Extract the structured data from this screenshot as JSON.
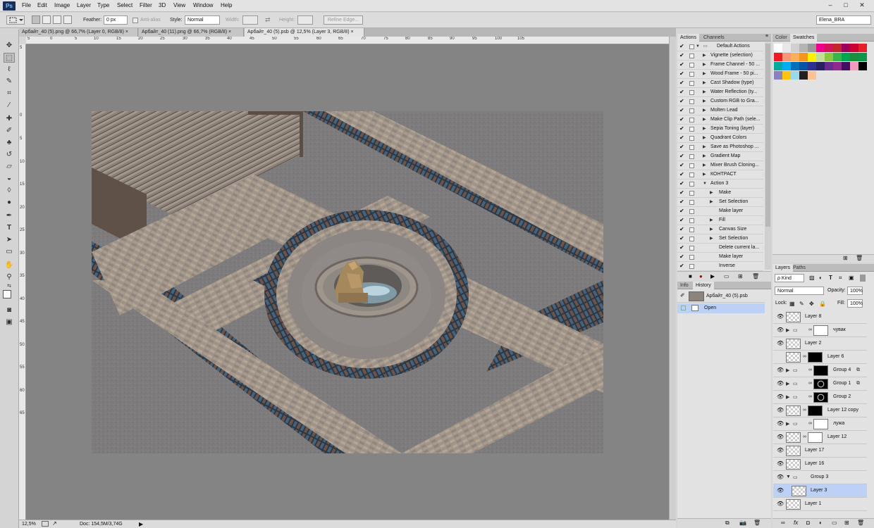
{
  "app": {
    "logo": "Ps",
    "user": "Elena_BRA"
  },
  "menu": [
    "File",
    "Edit",
    "Image",
    "Layer",
    "Type",
    "Select",
    "Filter",
    "3D",
    "View",
    "Window",
    "Help"
  ],
  "window_controls": [
    "–",
    "□",
    "✕"
  ],
  "options": {
    "feather_label": "Feather:",
    "feather_value": "0 px",
    "antialias_label": "Anti-alias",
    "style_label": "Style:",
    "style_value": "Normal",
    "width_label": "Width:",
    "height_label": "Height:",
    "refine_label": "Refine Edge..."
  },
  "tabs": [
    {
      "label": "Арбайт_40 (5).png @ 66,7% (Layer 0, RGB/8)",
      "close": "×"
    },
    {
      "label": "Арбайт_40 (11).png @ 66,7% (RGB/8)",
      "close": "×"
    },
    {
      "label": "Арбайт_40 (5).psb @ 12,5% (Layer 3, RGB/8)",
      "close": "×"
    }
  ],
  "ruler_top": [
    "5",
    "0",
    "5",
    "10",
    "15",
    "20",
    "25",
    "30",
    "35",
    "40",
    "45",
    "50",
    "55",
    "60",
    "65",
    "70",
    "75",
    "80",
    "85",
    "90",
    "95",
    "100",
    "105"
  ],
  "ruler_left": [
    "5",
    "0",
    "5",
    "10",
    "15",
    "20",
    "25",
    "30",
    "35",
    "40",
    "45",
    "50",
    "55",
    "60",
    "65"
  ],
  "status": {
    "zoom": "12,5%",
    "doc": "Doc: 154,5M/3,74G"
  },
  "actions_panel": {
    "tabs": [
      "Actions",
      "Channels"
    ],
    "rows": [
      {
        "label": "Default Actions",
        "level": 0,
        "open": true,
        "folder": true,
        "dialog": true
      },
      {
        "label": "Vignette (selection)",
        "level": 1,
        "dialog": true
      },
      {
        "label": "Frame Channel - 50 ...",
        "level": 1,
        "dialog": true
      },
      {
        "label": "Wood Frame - 50 pi...",
        "level": 1,
        "dialog": true
      },
      {
        "label": "Cast Shadow (type)",
        "level": 1,
        "dialog": false
      },
      {
        "label": "Water Reflection (ty...",
        "level": 1,
        "dialog": false
      },
      {
        "label": "Custom RGB to Gra...",
        "level": 1,
        "dialog": true
      },
      {
        "label": "Molten Lead",
        "level": 1,
        "dialog": false
      },
      {
        "label": "Make Clip Path (sele...",
        "level": 1,
        "dialog": true
      },
      {
        "label": "Sepia Toning (layer)",
        "level": 1,
        "dialog": false
      },
      {
        "label": "Quadrant Colors",
        "level": 1,
        "dialog": false
      },
      {
        "label": "Save as Photoshop ...",
        "level": 1,
        "dialog": true
      },
      {
        "label": "Gradient Map",
        "level": 1,
        "dialog": false
      },
      {
        "label": "Mixer Brush Cloning...",
        "level": 1,
        "dialog": true
      },
      {
        "label": "КОНТРАСТ",
        "level": 1,
        "dialog": false
      },
      {
        "label": "Action 3",
        "level": 1,
        "open": true,
        "dialog": false
      },
      {
        "label": "Make",
        "level": 2,
        "dialog": false
      },
      {
        "label": "Set Selection",
        "level": 2,
        "dialog": false
      },
      {
        "label": "Make layer",
        "level": 2,
        "leaf": true,
        "dialog": false
      },
      {
        "label": "Fill",
        "level": 2,
        "dialog": false
      },
      {
        "label": "Canvas Size",
        "level": 2,
        "dialog": false
      },
      {
        "label": "Set Selection",
        "level": 2,
        "dialog": false
      },
      {
        "label": "Delete current la...",
        "level": 2,
        "leaf": true,
        "dialog": false
      },
      {
        "label": "Make layer",
        "level": 2,
        "leaf": true,
        "dialog": false
      },
      {
        "label": "Inverse",
        "level": 2,
        "leaf": true,
        "dialog": false
      }
    ]
  },
  "swatches_panel": {
    "tabs": [
      "Color",
      "Swatches"
    ],
    "colors": [
      "#ffffff",
      "#e8e8e8",
      "#d0d0d0",
      "#b4b4b4",
      "#999999",
      "#ec008c",
      "#d4145a",
      "#c1272d",
      "#9e005d",
      "#cc0033",
      "#e61e28",
      "#ed1c24",
      "#f7977a",
      "#fbaf5d",
      "#f7941d",
      "#fff200",
      "#c4df9b",
      "#8dc63f",
      "#39b54a",
      "#00a651",
      "#1c8f3c",
      "#0f9648",
      "#00a99d",
      "#00aeef",
      "#0072bc",
      "#0054a6",
      "#2e3192",
      "#262262",
      "#662d91",
      "#92278f",
      "#440e62",
      "#f49ac1",
      "#000000",
      "#8781bd",
      "#ffc20e",
      "#9ad9ea",
      "#231f20",
      "#fbc393"
    ]
  },
  "history_panel": {
    "tabs": [
      "Info",
      "History"
    ],
    "snapshot": "Арбайт_40 (5).psb",
    "items": [
      "Open"
    ]
  },
  "layers_panel": {
    "tabs": [
      "Layers",
      "Paths"
    ],
    "kind": "ρ Kind",
    "blend": "Normal",
    "opacity_label": "Opacity:",
    "opacity": "100%",
    "lock_label": "Lock:",
    "fill_label": "Fill:",
    "fill": "100%",
    "layers": [
      {
        "name": "Layer 8",
        "visible": true,
        "type": "layer"
      },
      {
        "name": "чувак",
        "visible": true,
        "type": "group",
        "mask": "white"
      },
      {
        "name": "Layer 2",
        "visible": true,
        "type": "layer"
      },
      {
        "name": "Layer 6",
        "visible": false,
        "type": "layer",
        "mask": "black"
      },
      {
        "name": "Group 4",
        "visible": true,
        "type": "group",
        "mask": "black"
      },
      {
        "name": "Group 1",
        "visible": true,
        "type": "group",
        "mask": "ring"
      },
      {
        "name": "Group 2",
        "visible": true,
        "type": "group",
        "mask": "ring"
      },
      {
        "name": "Layer 12 copy",
        "visible": true,
        "type": "layer",
        "mask": "black"
      },
      {
        "name": "лужа",
        "visible": true,
        "type": "group",
        "mask": "white"
      },
      {
        "name": "Layer 12",
        "visible": true,
        "type": "layer",
        "mask": "white"
      },
      {
        "name": "Layer 17",
        "visible": true,
        "type": "layer"
      },
      {
        "name": "Layer 16",
        "visible": true,
        "type": "layer"
      },
      {
        "name": "Group 3",
        "visible": true,
        "type": "group",
        "open": true
      },
      {
        "name": "Layer 3",
        "visible": true,
        "type": "layer",
        "selected": true
      },
      {
        "name": "Layer 1",
        "visible": true,
        "type": "layer"
      }
    ]
  }
}
